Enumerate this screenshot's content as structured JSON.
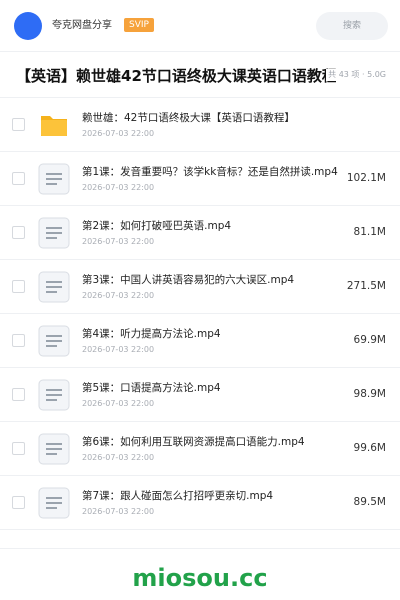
{
  "header": {
    "username": "夸克网盘分享",
    "badge": "SVIP",
    "search_placeholder": "搜索"
  },
  "share": {
    "title": "【英语】赖世雄42节口语终极大课英语口语教程",
    "meta": "共 43 项 · 5.0G"
  },
  "files": [
    {
      "name": "赖世雄：42节口语终极大课【英语口语教程】",
      "date": "2026-07-03 22:00",
      "size": "",
      "icon": "folder-icon"
    },
    {
      "name": "第1课：发音重要吗？该学kk音标？还是自然拼读.mp4",
      "date": "2026-07-03 22:00",
      "size": "102.1M",
      "icon": "video-file-icon"
    },
    {
      "name": "第2课：如何打破哑巴英语.mp4",
      "date": "2026-07-03 22:00",
      "size": "81.1M",
      "icon": "video-file-icon"
    },
    {
      "name": "第3课：中国人讲英语容易犯的六大误区.mp4",
      "date": "2026-07-03 22:00",
      "size": "271.5M",
      "icon": "video-file-icon"
    },
    {
      "name": "第4课：听力提高方法论.mp4",
      "date": "2026-07-03 22:00",
      "size": "69.9M",
      "icon": "video-file-icon"
    },
    {
      "name": "第5课：口语提高方法论.mp4",
      "date": "2026-07-03 22:00",
      "size": "98.9M",
      "icon": "video-file-icon"
    },
    {
      "name": "第6课：如何利用互联网资源提高口语能力.mp4",
      "date": "2026-07-03 22:00",
      "size": "99.6M",
      "icon": "video-file-icon"
    },
    {
      "name": "第7课：跟人碰面怎么打招呼更亲切.mp4",
      "date": "2026-07-03 22:00",
      "size": "89.5M",
      "icon": "video-file-icon"
    }
  ],
  "watermark": "miosou.cc",
  "colors": {
    "accent": "#2e6cf5",
    "svip": "#f6a23b",
    "folder": "#fcc33a",
    "watermark": "#22a24a"
  }
}
